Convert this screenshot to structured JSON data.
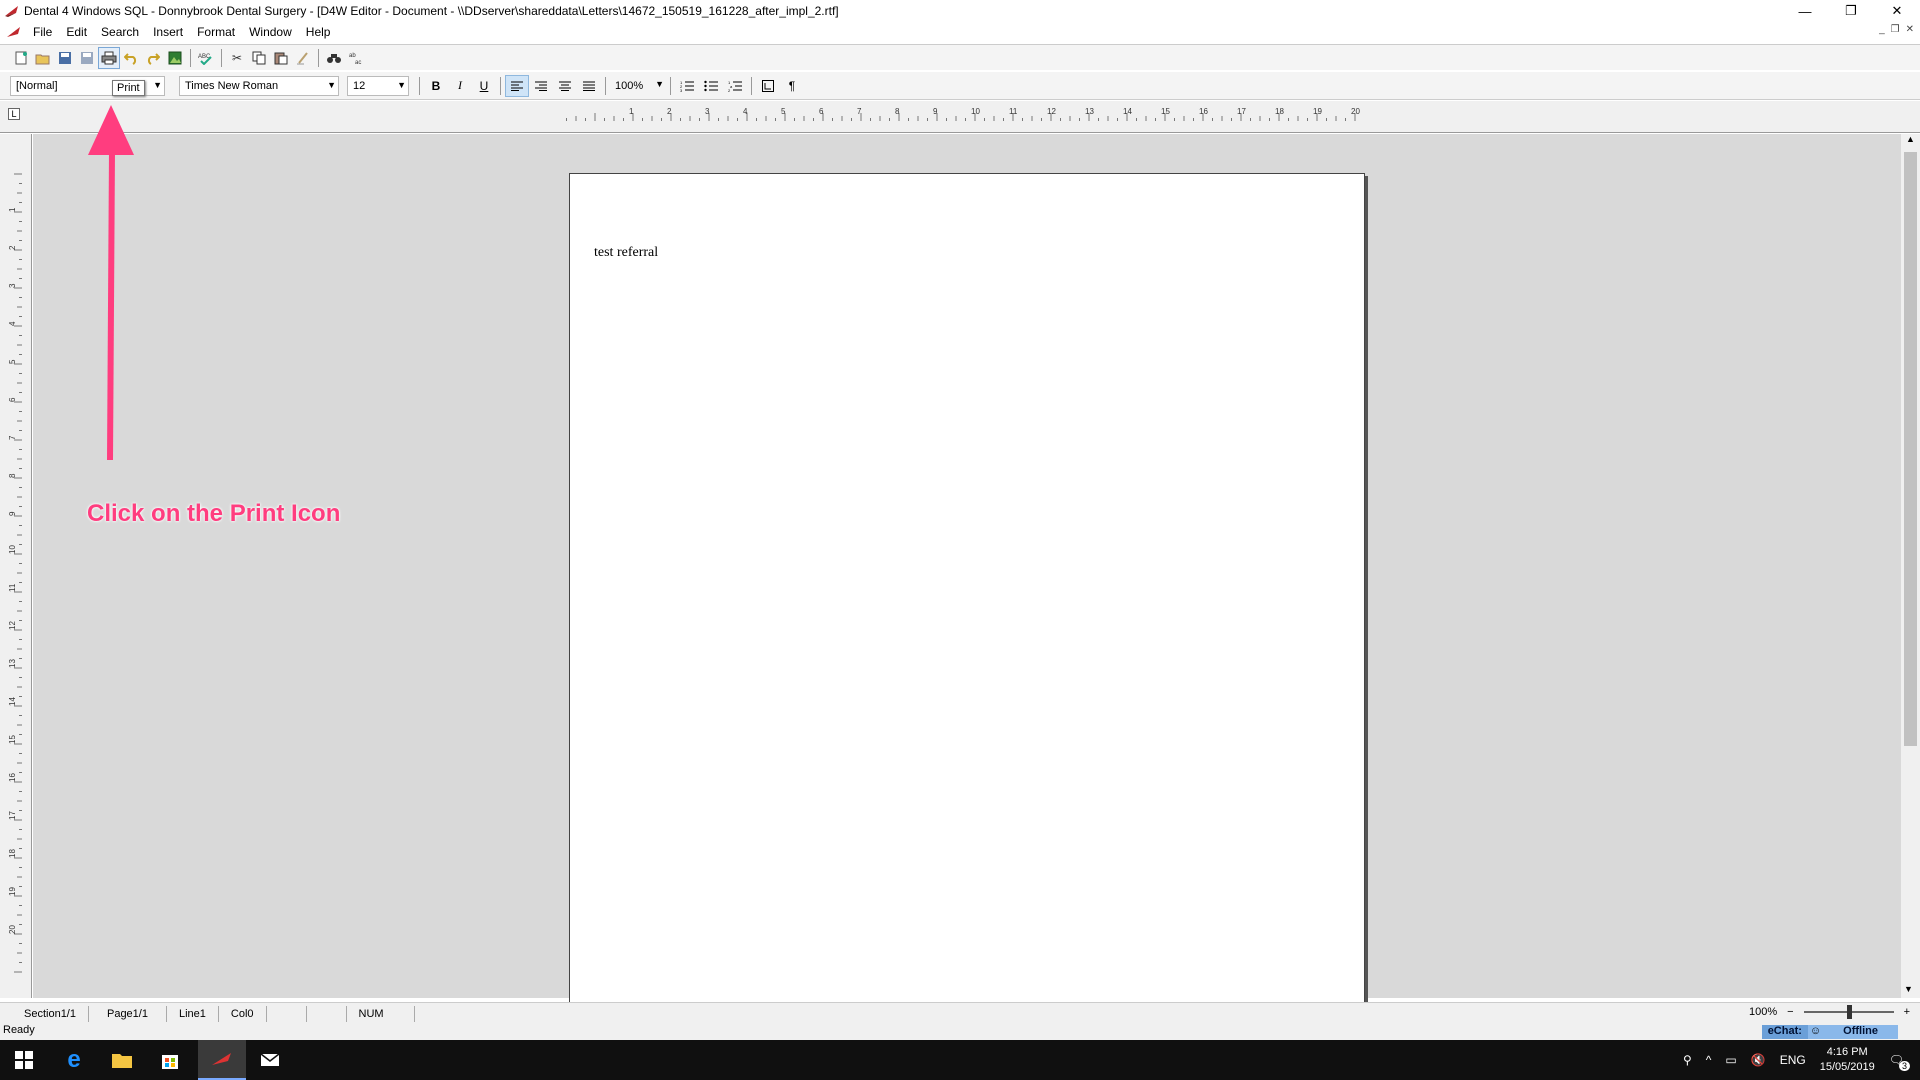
{
  "window": {
    "title": "Dental 4 Windows SQL - Donnybrook Dental Surgery - [D4W Editor - Document - \\\\DDserver\\shareddata\\Letters\\14672_150519_161228_after_impl_2.rtf]",
    "minimize_glyph": "—",
    "restore_glyph": "❐",
    "close_glyph": "✕"
  },
  "menu": [
    "File",
    "Edit",
    "Search",
    "Insert",
    "Format",
    "Window",
    "Help"
  ],
  "toolbar": {
    "icons": [
      "new-doc-icon",
      "open-icon",
      "save-icon",
      "save-all-icon",
      "print-icon",
      "undo-icon",
      "redo-icon",
      "insert-image-icon",
      "spellcheck-icon",
      "cut-icon",
      "copy-icon",
      "paste-icon",
      "clear-icon",
      "find-icon",
      "replace-icon"
    ],
    "tooltip": "Print"
  },
  "format": {
    "style": "[Normal]",
    "font": "Times New Roman",
    "size": "12",
    "bold": "B",
    "italic": "I",
    "underline": "U",
    "zoom": "100%",
    "paragraph": "¶"
  },
  "ruler": {
    "h_numbers": [
      "1",
      "2",
      "3",
      "4",
      "5",
      "6",
      "7",
      "8",
      "9",
      "10",
      "11",
      "12",
      "13",
      "14",
      "15",
      "16",
      "17",
      "18",
      "19",
      "20"
    ],
    "v_numbers": [
      "1",
      "2",
      "3",
      "4",
      "5",
      "6",
      "7",
      "8",
      "9",
      "10",
      "11",
      "12",
      "13",
      "14",
      "15",
      "16",
      "17",
      "18",
      "19",
      "20"
    ],
    "tab_selector": "L"
  },
  "document": {
    "text": "test referral"
  },
  "status": {
    "section": "Section1/1",
    "page": "Page1/1",
    "line": "Line1",
    "col": "Col0",
    "num": "NUM",
    "zoom": "100%",
    "ready": "Ready",
    "echat_label": "eChat:",
    "echat_status": "Offline"
  },
  "taskbar": {
    "language": "ENG",
    "time": "4:16 PM",
    "date": "15/05/2019",
    "notifications": "3"
  },
  "annotation": {
    "text": "Click on the Print Icon",
    "color": "#ff3d7f"
  }
}
